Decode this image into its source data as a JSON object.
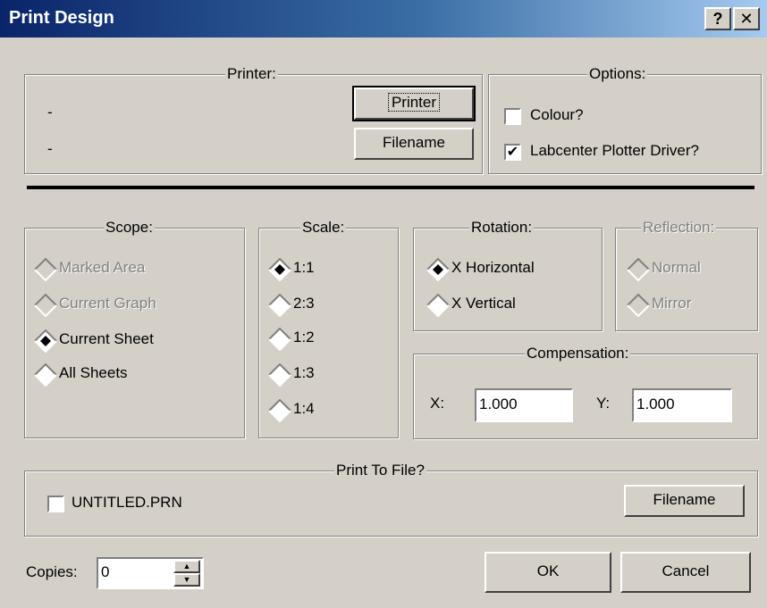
{
  "window": {
    "title": "Print Design",
    "help_label": "?",
    "close_label": "✕"
  },
  "printer": {
    "group_title": "Printer:",
    "line1": "-",
    "line2": "-",
    "printer_button": "Printer",
    "filename_button": "Filename"
  },
  "options": {
    "group_title": "Options:",
    "colour_label": "Colour?",
    "colour_checked": false,
    "labcenter_label": "Labcenter Plotter Driver?",
    "labcenter_checked": true
  },
  "scope": {
    "group_title": "Scope:",
    "items": [
      {
        "label": "Marked Area",
        "checked": false,
        "enabled": false
      },
      {
        "label": "Current Graph",
        "checked": false,
        "enabled": false
      },
      {
        "label": "Current Sheet",
        "checked": true,
        "enabled": true
      },
      {
        "label": "All Sheets",
        "checked": false,
        "enabled": true
      }
    ]
  },
  "scale": {
    "group_title": "Scale:",
    "items": [
      {
        "label": "1:1",
        "checked": true
      },
      {
        "label": "2:3",
        "checked": false
      },
      {
        "label": "1:2",
        "checked": false
      },
      {
        "label": "1:3",
        "checked": false
      },
      {
        "label": "1:4",
        "checked": false
      }
    ]
  },
  "rotation": {
    "group_title": "Rotation:",
    "items": [
      {
        "label": "X Horizontal",
        "checked": true
      },
      {
        "label": "X Vertical",
        "checked": false
      }
    ]
  },
  "reflection": {
    "group_title": "Reflection:",
    "items": [
      {
        "label": "Normal",
        "checked": false,
        "enabled": false
      },
      {
        "label": "Mirror",
        "checked": false,
        "enabled": false
      }
    ]
  },
  "compensation": {
    "group_title": "Compensation:",
    "x_label": "X:",
    "x_value": "1.000",
    "y_label": "Y:",
    "y_value": "1.000"
  },
  "print_to_file": {
    "group_title": "Print To File?",
    "file_label": "UNTITLED.PRN",
    "checked": false,
    "filename_button": "Filename"
  },
  "copies": {
    "label": "Copies:",
    "value": "0"
  },
  "buttons": {
    "ok": "OK",
    "cancel": "Cancel"
  }
}
